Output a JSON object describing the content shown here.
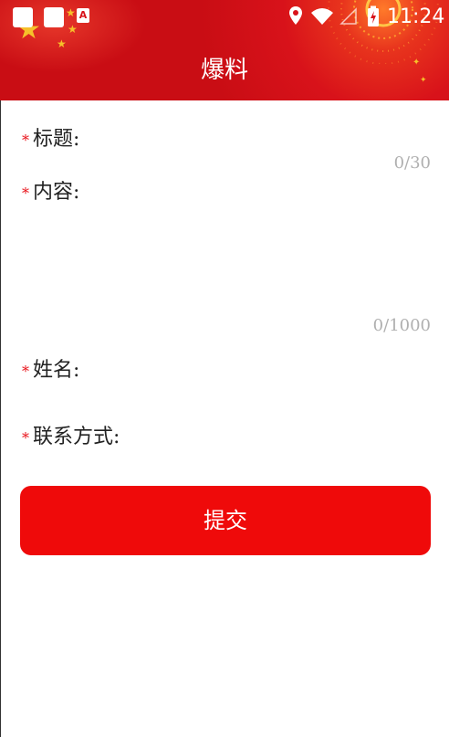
{
  "status_bar": {
    "time": "11:24",
    "app_badge": "A"
  },
  "header": {
    "title": "爆料"
  },
  "form": {
    "required_mark": "*",
    "title_label": "标题:",
    "title_counter": "0/30",
    "content_label": "内容:",
    "content_counter": "0/1000",
    "name_label": "姓名:",
    "contact_label": "联系方式:"
  },
  "submit": {
    "label": "提交"
  },
  "colors": {
    "brand_red": "#d8121a",
    "button_red": "#ef0a0a",
    "required_red": "#e8121a",
    "counter_gray": "#b0b0b0"
  }
}
